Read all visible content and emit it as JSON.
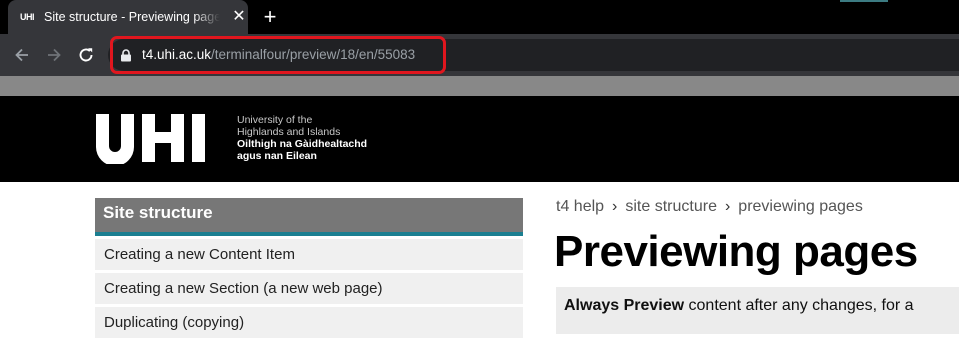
{
  "browser": {
    "tab": {
      "favicon_text": "UHI",
      "title": "Site structure - Previewing pages - UHI"
    },
    "address_bar": {
      "host": "t4.uhi.ac.uk",
      "path": "/terminalfour/preview/18/en/55083"
    }
  },
  "header": {
    "logo_text": "UHI",
    "name_en_line1": "University of the",
    "name_en_line2": "Highlands and Islands",
    "name_gd_line1": "Oilthigh na Gàidhealtachd",
    "name_gd_line2": "agus nan Eilean"
  },
  "sidebar": {
    "title": "Site structure",
    "items": [
      {
        "label": "Creating a new Content Item"
      },
      {
        "label": "Creating a new Section (a new web page)"
      },
      {
        "label": "Duplicating (copying)"
      }
    ]
  },
  "breadcrumb": [
    "t4 help",
    "site structure",
    "previewing pages"
  ],
  "breadcrumb_separator": "›",
  "page_title": "Previewing pages",
  "note": {
    "bold": "Always Preview",
    "text": " content after any changes, for a"
  },
  "colors": {
    "annotation": "#e0161e",
    "sidebar_accent": "#1b7f91",
    "sidebar_title_bg": "#777777"
  }
}
